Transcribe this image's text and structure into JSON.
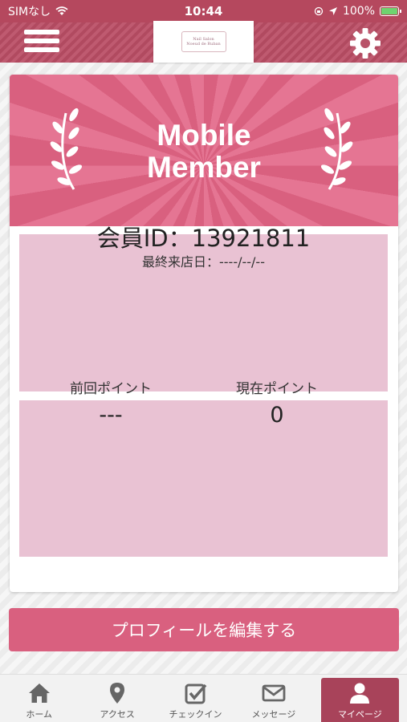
{
  "status_bar": {
    "carrier": "SIMなし",
    "time": "10:44",
    "battery": "100%"
  },
  "header": {
    "logo_line1": "Nail Salon",
    "logo_line2": "Noeud de Ruban"
  },
  "banner": {
    "title_line1": "Mobile",
    "title_line2": "Member"
  },
  "member": {
    "id_text": "会員ID：13921811",
    "last_visit": "最終来店日：----/--/--"
  },
  "points": {
    "previous_label": "前回ポイント",
    "previous_value": "---",
    "current_label": "現在ポイント",
    "current_value": "0"
  },
  "edit_profile_label": "プロフィールを編集する",
  "tabs": [
    {
      "label": "ホーム",
      "icon": "home-icon"
    },
    {
      "label": "アクセス",
      "icon": "map-pin-icon"
    },
    {
      "label": "チェックイン",
      "icon": "checkin-icon"
    },
    {
      "label": "メッセージ",
      "icon": "mail-icon"
    },
    {
      "label": "マイページ",
      "icon": "user-icon",
      "active": true
    }
  ],
  "colors": {
    "brand": "#b5485e",
    "accent": "#d9607f",
    "panel": "#e9c2d3"
  }
}
